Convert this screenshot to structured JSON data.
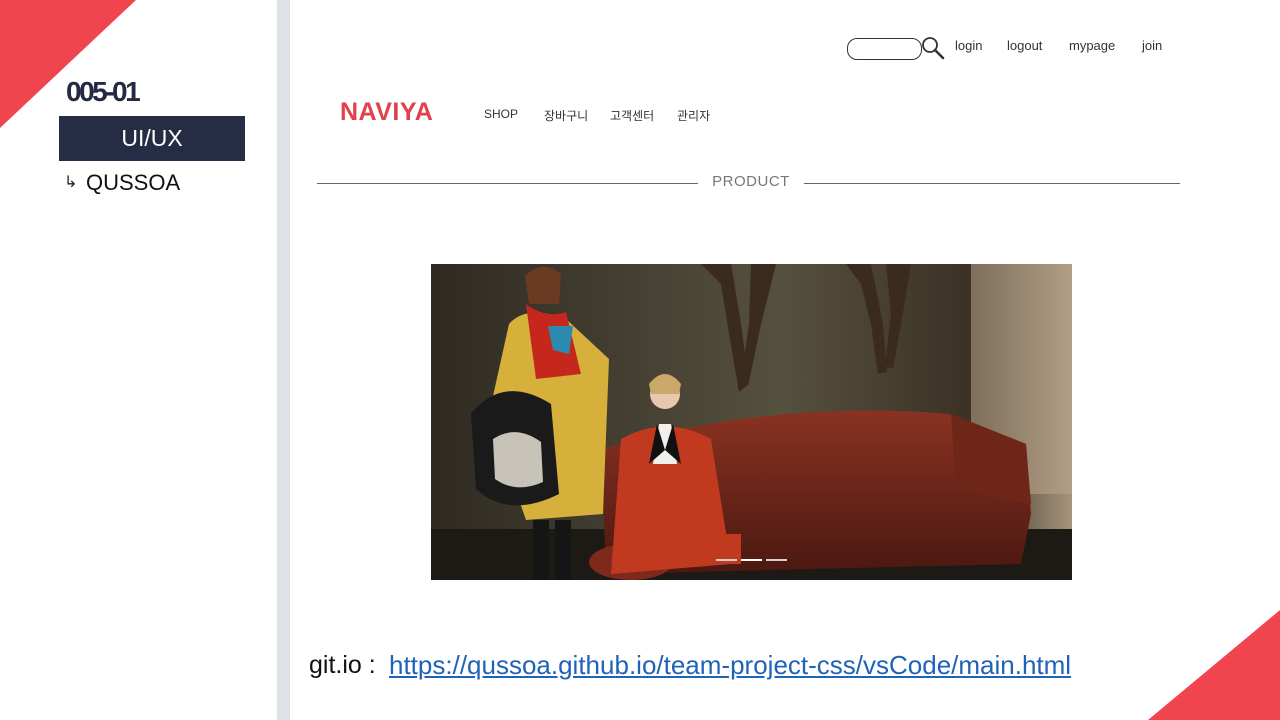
{
  "slide": {
    "id": "005-01",
    "category": "UI/UX",
    "sub_arrow": "↳",
    "sub_label": "QUSSOA",
    "accent_color": "#f0454f",
    "dark_color": "#262c44"
  },
  "site": {
    "brand": "NAVIYA",
    "brand_color": "#e3404c",
    "search": {
      "placeholder": "",
      "icon": "search-icon"
    },
    "top_links": [
      "login",
      "logout",
      "mypage",
      "join"
    ],
    "nav": [
      "SHOP",
      "장바구니",
      "고객센터",
      "관리자"
    ],
    "section_title": "PRODUCT",
    "slider": {
      "count": 3,
      "active_index": 1
    }
  },
  "footer": {
    "label": "git.io :",
    "url": "https://qussoa.github.io/team-project-css/vsCode/main.html",
    "link_color": "#1f63b8"
  }
}
